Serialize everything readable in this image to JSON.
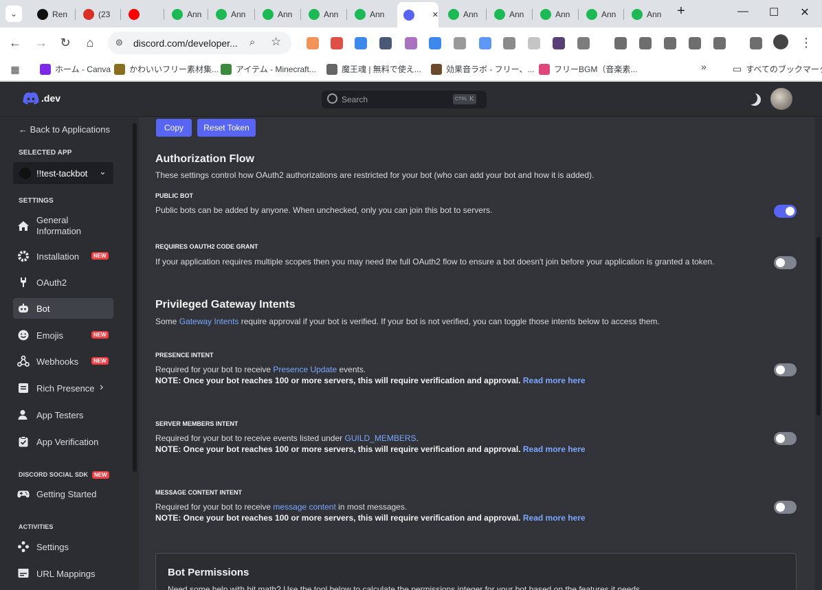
{
  "browser": {
    "tabs": [
      {
        "label": "Ren",
        "color": "#111111"
      },
      {
        "label": "(23",
        "color": "#d93025"
      },
      {
        "label": "",
        "color": "#ff0000"
      },
      {
        "label": "Ann",
        "color": "#1db954"
      },
      {
        "label": "Ann",
        "color": "#1db954"
      },
      {
        "label": "Ann",
        "color": "#1db954"
      },
      {
        "label": "Ann",
        "color": "#1db954"
      },
      {
        "label": "Ann",
        "color": "#1db954"
      },
      {
        "label": "",
        "color": "#5865f2"
      },
      {
        "label": "Ann",
        "color": "#1db954"
      },
      {
        "label": "Ann",
        "color": "#1db954"
      },
      {
        "label": "Ann",
        "color": "#1db954"
      },
      {
        "label": "Ann",
        "color": "#1db954"
      },
      {
        "label": "Ann",
        "color": "#1db954"
      }
    ],
    "url": "discord.com/developer...",
    "bookmarks": [
      {
        "label": "ホーム - Canva",
        "color": "#7d2ae8"
      },
      {
        "label": "かわいいフリー素材集...",
        "color": "#8a6d1f"
      },
      {
        "label": "アイテム - Minecraft...",
        "color": "#3b8a3b"
      },
      {
        "label": "魔王魂 | 無料で使え...",
        "color": "#666666"
      },
      {
        "label": "効果音ラボ - フリー、...",
        "color": "#6b4a2b"
      },
      {
        "label": "フリーBGM（音楽素...",
        "color": "#e0457b"
      }
    ],
    "all_bookmarks": "すべてのブックマーク",
    "overflow": "»"
  },
  "header": {
    "logo_text": ".dev",
    "search_placeholder": "Search",
    "kbd_ctrl": "CTRL",
    "kbd_k": "K"
  },
  "sidebar": {
    "back": "← Back to Applications",
    "selected_app_label": "SELECTED APP",
    "app_name": "!!test-tackbot",
    "settings_label": "SETTINGS",
    "items": [
      {
        "label": "General Information",
        "icon": "home-icon"
      },
      {
        "label": "Installation",
        "icon": "gear-icon",
        "badge": "NEW"
      },
      {
        "label": "OAuth2",
        "icon": "wrench-icon"
      },
      {
        "label": "Bot",
        "icon": "bot-icon"
      },
      {
        "label": "Emojis",
        "icon": "smile-icon",
        "badge": "NEW"
      },
      {
        "label": "Webhooks",
        "icon": "webhook-icon",
        "badge": "NEW"
      },
      {
        "label": "Rich Presence",
        "icon": "document-icon"
      },
      {
        "label": "App Testers",
        "icon": "person-icon"
      },
      {
        "label": "App Verification",
        "icon": "clipboard-check-icon"
      }
    ],
    "social_sdk_label": "DISCORD SOCIAL SDK",
    "social_sdk_badge": "NEW",
    "getting_started": "Getting Started",
    "activities_label": "ACTIVITIES",
    "activity_settings": "Settings",
    "url_mappings": "URL Mappings"
  },
  "main": {
    "copy_button": "Copy",
    "reset_button": "Reset Token",
    "auth_title": "Authorization Flow",
    "auth_desc": "These settings control how OAuth2 authorizations are restricted for your bot (who can add your bot and how it is added).",
    "public_bot_label": "PUBLIC BOT",
    "public_bot_desc": "Public bots can be added by anyone. When unchecked, only you can join this bot to servers.",
    "public_bot_on": true,
    "code_grant_label": "REQUIRES OAUTH2 CODE GRANT",
    "code_grant_desc": "If your application requires multiple scopes then you may need the full OAuth2 flow to ensure a bot doesn't join before your application is granted a token.",
    "code_grant_on": false,
    "intents_title": "Privileged Gateway Intents",
    "intents_desc_pre": "Some ",
    "intents_desc_link": "Gateway Intents",
    "intents_desc_post": " require approval if your bot is verified. If your bot is not verified, you can toggle those intents below to access them.",
    "presence_label": "PRESENCE INTENT",
    "presence_pre": "Required for your bot to receive ",
    "presence_link": "Presence Update",
    "presence_post": " events.",
    "members_label": "SERVER MEMBERS INTENT",
    "members_pre": "Required for your bot to receive events listed under ",
    "members_link": "GUILD_MEMBERS",
    "members_post": ".",
    "content_label": "MESSAGE CONTENT INTENT",
    "content_pre": "Required for your bot to receive ",
    "content_link": "message content",
    "content_post": " in most messages.",
    "note": "NOTE: Once your bot reaches 100 or more servers, this will require verification and approval.",
    "read_more": "Read more here",
    "perm_title": "Bot Permissions",
    "perm_desc": "Need some help with bit math? Use the tool below to calculate the permissions integer for your bot based on the features it needs."
  }
}
